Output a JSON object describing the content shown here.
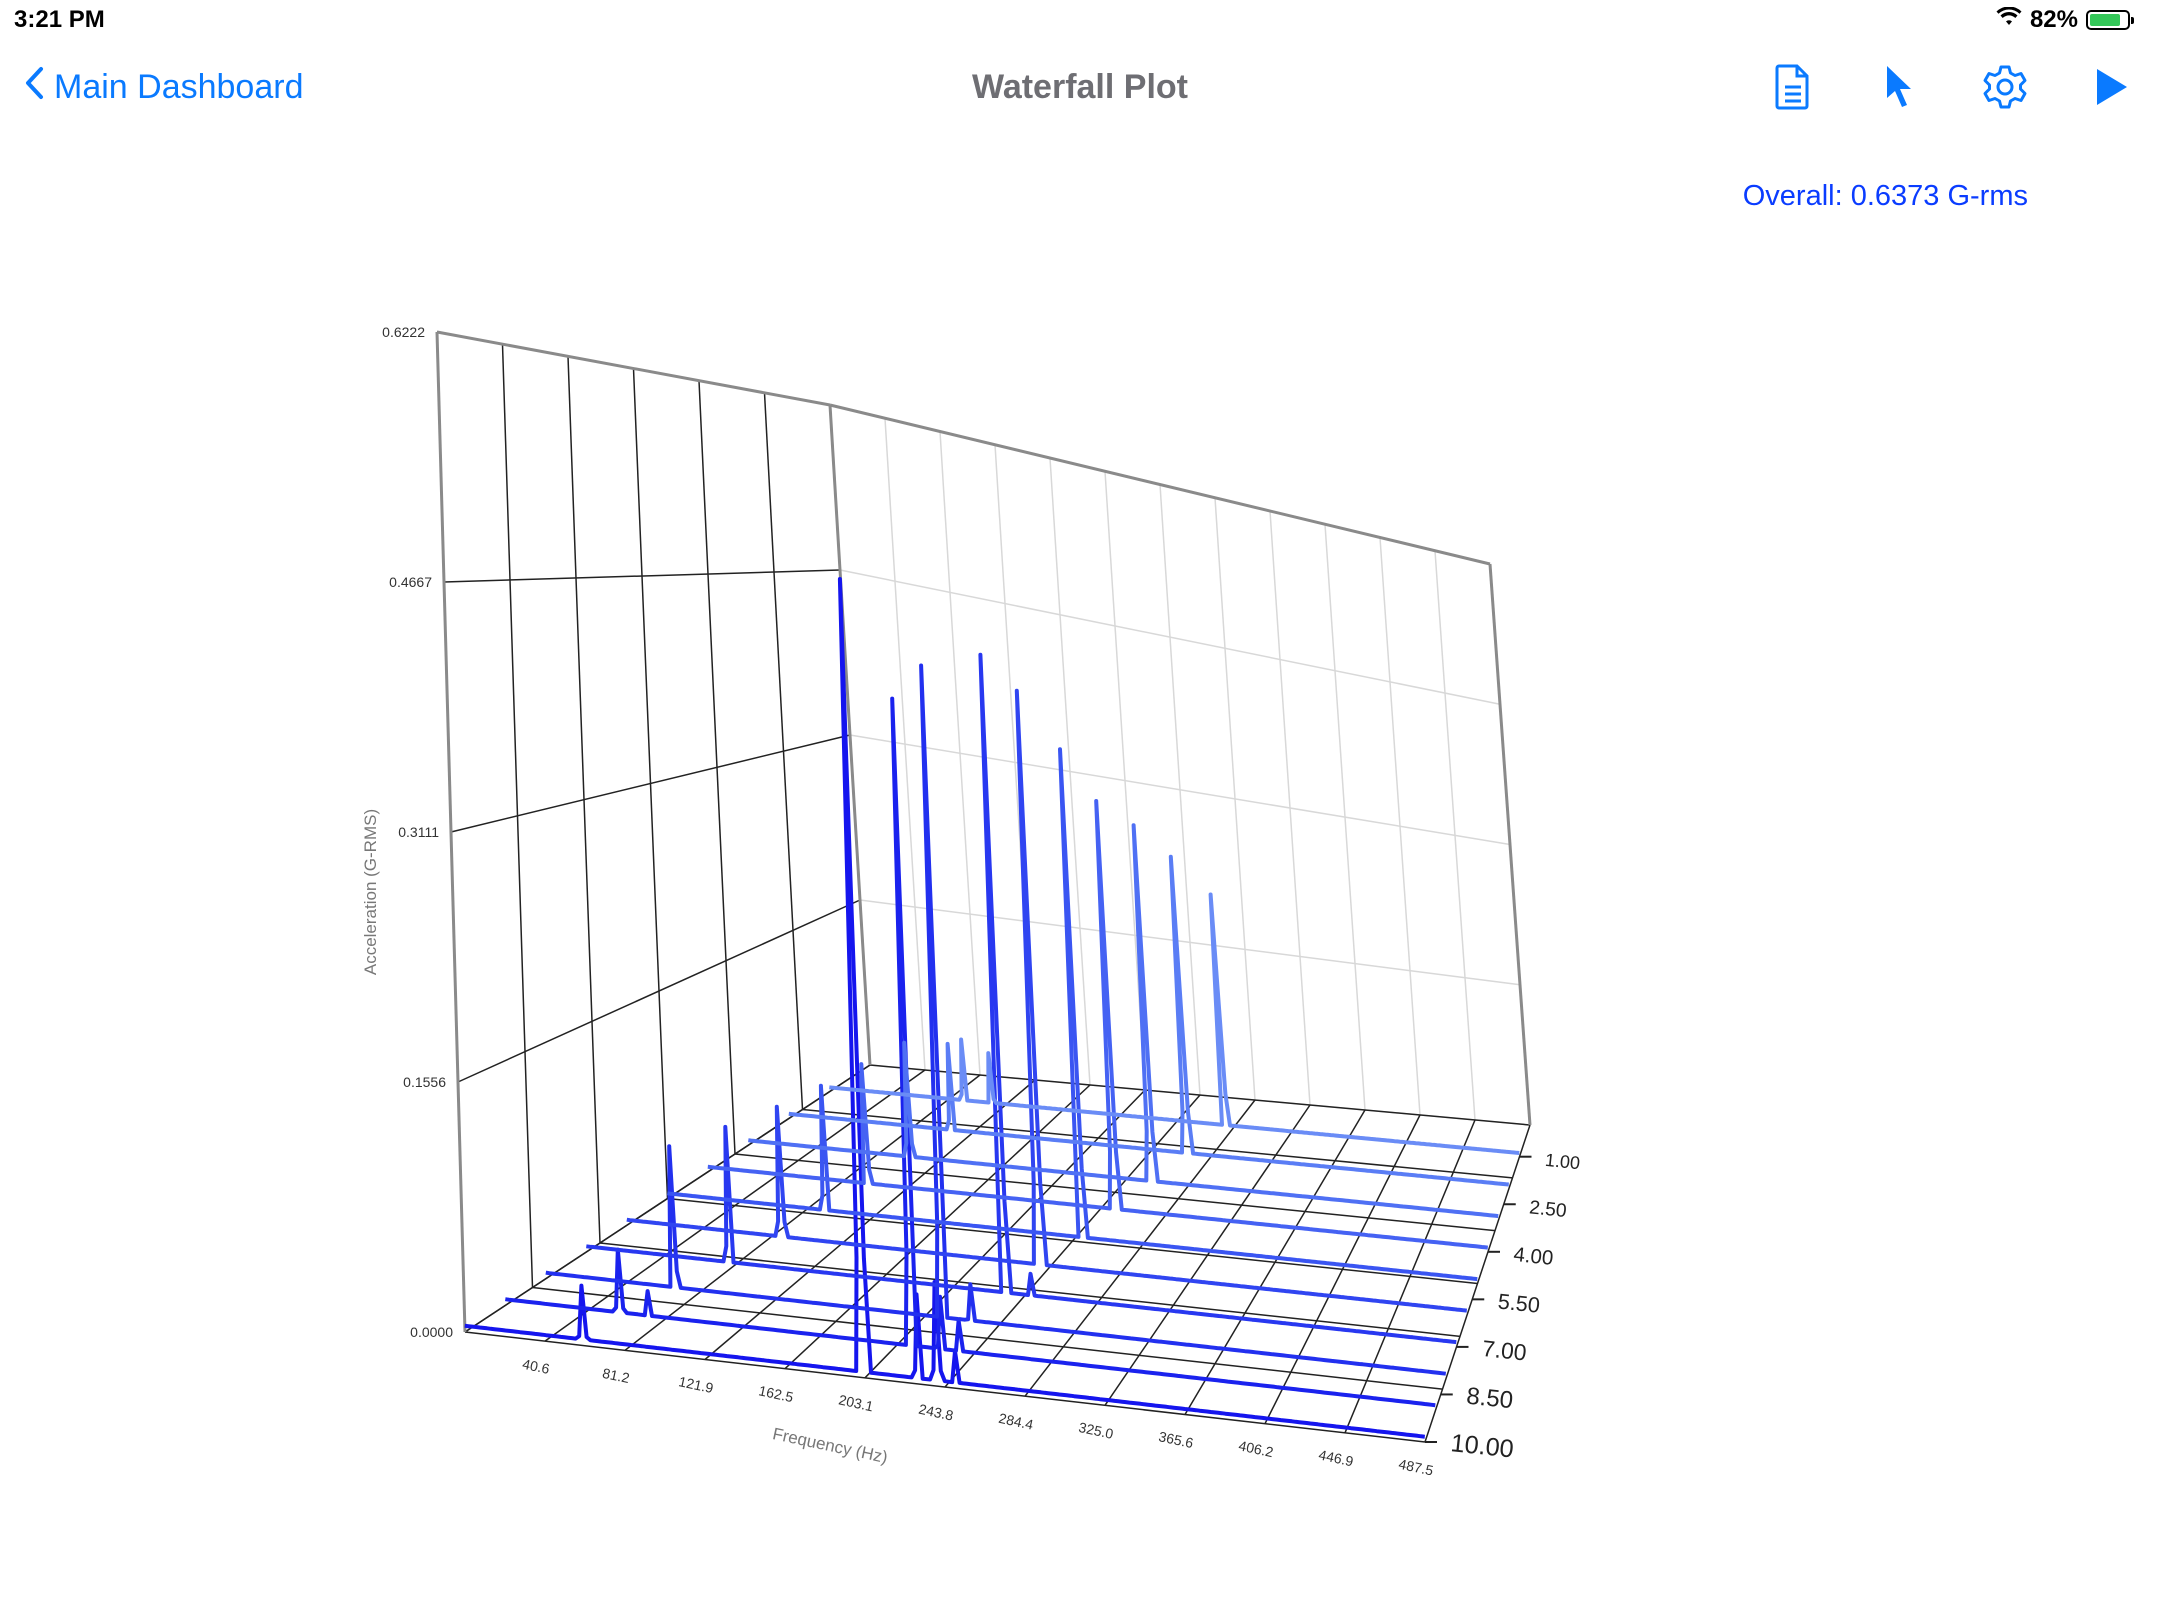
{
  "status_bar": {
    "time": "3:21 PM",
    "battery_percent": "82%",
    "battery_level": 0.82,
    "charging": true
  },
  "nav": {
    "back_label": "Main Dashboard",
    "title": "Waterfall Plot",
    "icons": [
      "document-icon",
      "pointer-icon",
      "gear-icon",
      "play-icon"
    ],
    "accent_color": "#0a7aff"
  },
  "overall_label": "Overall: 0.6373 G-rms",
  "chart_data": {
    "type": "waterfall",
    "ylabel": "Acceleration (G-RMS)",
    "xlabel": "Frequency (Hz)",
    "z_tick_labels": [
      "0.0000",
      "0.1556",
      "0.3111",
      "0.4667",
      "0.6222"
    ],
    "x_tick_labels": [
      "40.6",
      "81.2",
      "121.9",
      "162.5",
      "203.1",
      "243.8",
      "284.4",
      "325.0",
      "365.6",
      "406.2",
      "446.9",
      "487.5"
    ],
    "y_tick_labels": [
      "1.00",
      "2.50",
      "4.00",
      "5.50",
      "7.00",
      "8.50",
      "10.00"
    ],
    "zlim": [
      0,
      0.6222
    ],
    "xlim": [
      0,
      487.5
    ],
    "ylim": [
      0,
      10.0
    ],
    "series": [
      {
        "time": 10.0,
        "color": "#1515ee",
        "peaks": [
          [
            60,
            0.038
          ],
          [
            203,
            0.53
          ],
          [
            230,
            0.06
          ],
          [
            240,
            0.07
          ],
          [
            250,
            0.025
          ]
        ]
      },
      {
        "time": 9.0,
        "color": "#1a22ee",
        "peaks": [
          [
            60,
            0.045
          ],
          [
            75,
            0.02
          ],
          [
            213,
            0.45
          ],
          [
            228,
            0.04
          ],
          [
            238,
            0.025
          ]
        ]
      },
      {
        "time": 8.0,
        "color": "#2230ef",
        "peaks": [
          [
            70,
            0.1
          ],
          [
            215,
            0.47
          ],
          [
            230,
            0.03
          ]
        ]
      },
      {
        "time": 7.0,
        "color": "#2838f0",
        "peaks": [
          [
            80,
            0.1
          ],
          [
            235,
            0.48
          ],
          [
            250,
            0.02
          ]
        ]
      },
      {
        "time": 6.0,
        "color": "#3045f1",
        "peaks": [
          [
            90,
            0.1
          ],
          [
            240,
            0.45
          ]
        ]
      },
      {
        "time": 5.0,
        "color": "#3a55f2",
        "peaks": [
          [
            95,
            0.1
          ],
          [
            250,
            0.4
          ]
        ]
      },
      {
        "time": 4.0,
        "color": "#4562f3",
        "peaks": [
          [
            100,
            0.1
          ],
          [
            255,
            0.35
          ]
        ]
      },
      {
        "time": 3.0,
        "color": "#4f70f4",
        "peaks": [
          [
            105,
            0.1
          ],
          [
            262,
            0.32
          ]
        ]
      },
      {
        "time": 2.0,
        "color": "#5a7df5",
        "peaks": [
          [
            110,
            0.08
          ],
          [
            270,
            0.28
          ]
        ]
      },
      {
        "time": 1.0,
        "color": "#6a8cf6",
        "peaks": [
          [
            95,
            0.06
          ],
          [
            115,
            0.05
          ],
          [
            280,
            0.23
          ]
        ]
      }
    ],
    "grid": true,
    "line_color": "#1a22ee"
  }
}
